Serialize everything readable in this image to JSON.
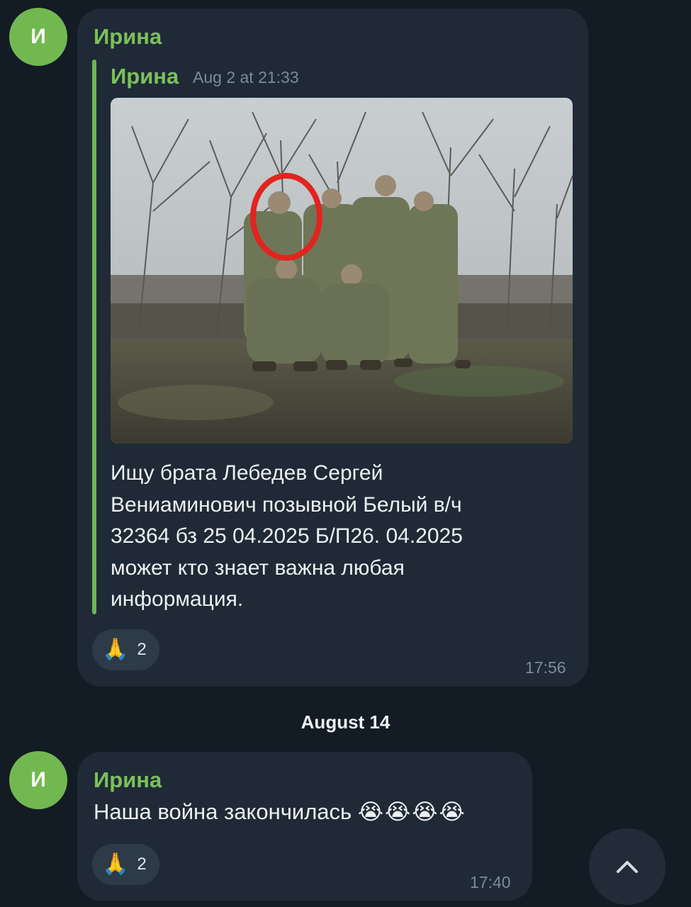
{
  "messages": [
    {
      "avatar_letter": "И",
      "sender": "Ирина",
      "forwarded": {
        "name": "Ирина",
        "date": "Aug 2 at 21:33"
      },
      "caption": "Ищу брата Лебедев Сергей\nВениаминович   позывной Белый в/ч\n32364  бз 25 04.2025 Б/П26. 04.2025\nможет кто знает важна любая\nинформация.",
      "reaction": {
        "emoji": "🙏",
        "count": "2"
      },
      "time": "17:56"
    },
    {
      "avatar_letter": "И",
      "sender": "Ирина",
      "text": "Наша война закончилась",
      "emojis": "😭😭😭😭",
      "reaction": {
        "emoji": "🙏",
        "count": "2"
      },
      "time": "17:40"
    }
  ],
  "date_separator": "August 14",
  "icons": {
    "scroll_button": "chevron-up-icon"
  },
  "colors": {
    "background": "#131b25",
    "bubble": "#1f2a36",
    "accent_green": "#7cc05c",
    "avatar": "#72b850"
  }
}
